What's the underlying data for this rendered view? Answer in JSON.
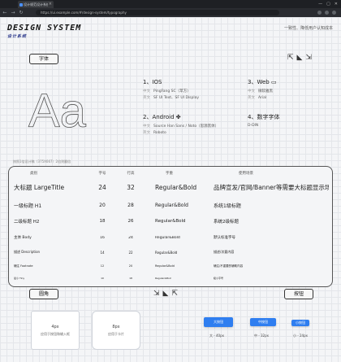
{
  "browser": {
    "tab_title": "设计规范设计系统 - 组件库",
    "url": "https://ui.example.com/#/design-system/typography",
    "window_controls": [
      "—",
      "▢",
      "✕"
    ]
  },
  "brand": {
    "title": "DESIGN SYSTEM",
    "subtitle": "设计系统",
    "tagline": "一致性、降低用户认知成本"
  },
  "sections": {
    "font": "字体",
    "radius": "圆角",
    "button": "按钮"
  },
  "glyph_sample": "Aa",
  "font_families": [
    {
      "heading": "1、IOS",
      "icon": "apple-icon",
      "rows": [
        {
          "key": "中文",
          "value": "PingFang SC（苹方）"
        },
        {
          "key": "英文",
          "value": "SF UI Text、SF UI Display"
        }
      ]
    },
    {
      "heading": "2、Android",
      "icon": "android-icon",
      "rows": [
        {
          "key": "中文",
          "value": "Source Han Sans / Noto（思源黑体）"
        },
        {
          "key": "英文",
          "value": "Roboto"
        }
      ]
    },
    {
      "heading": "3、Web",
      "icon": "monitor-icon",
      "rows": [
        {
          "key": "中文",
          "value": "微软雅黑"
        },
        {
          "key": "英文",
          "value": "Arial"
        }
      ]
    },
    {
      "heading": "4、数字字体",
      "icon": "",
      "rows": [
        {
          "key": "",
          "value": "D-DIN"
        }
      ]
    }
  ],
  "table_note": "按照1倍设计稿（375X667）2倍则翻倍",
  "type_table": {
    "headers": [
      "类别",
      "字号",
      "行高",
      "字重",
      "使用场景"
    ],
    "rows": [
      {
        "category": "大标题 LargeTitle",
        "size": "24",
        "line_height": "32",
        "weight": "Regular&Bold",
        "usage": "品牌宣发/官网/Banner等需要大标题显示场景"
      },
      {
        "category": "一级标题 H1",
        "size": "20",
        "line_height": "28",
        "weight": "Regular&Bold",
        "usage": "系统1级标题"
      },
      {
        "category": "二级标题 H2",
        "size": "18",
        "line_height": "26",
        "weight": "Regular&Bold",
        "usage": "系统2级标题"
      },
      {
        "category": "主体 Body",
        "size": "16",
        "line_height": "24",
        "weight": "Regular&Bold",
        "usage": "默认标准字号"
      },
      {
        "category": "描述 Description",
        "size": "14",
        "line_height": "22",
        "weight": "Regular&Bold",
        "usage": "描述/次要内容"
      },
      {
        "category": "辅注 Footnote",
        "size": "12",
        "line_height": "20",
        "weight": "Regular&Bold",
        "usage": "辅注/不重要的辅助内容"
      },
      {
        "category": "最小 Tiny",
        "size": "10",
        "line_height": "18",
        "weight": "Regular&Bold",
        "usage": "极小字号"
      }
    ]
  },
  "radius_cards": [
    {
      "value": "4px",
      "desc": "应用于按钮和输入框"
    },
    {
      "value": "8px",
      "desc": "应用于卡片"
    }
  ],
  "buttons": [
    {
      "label": "大按钮",
      "caption": "大 - 40px"
    },
    {
      "label": "中按钮",
      "caption": "中 - 32px"
    },
    {
      "label": "小按钮",
      "caption": "小 - 24px"
    }
  ],
  "colors": {
    "primary": "#2f7ef0"
  }
}
